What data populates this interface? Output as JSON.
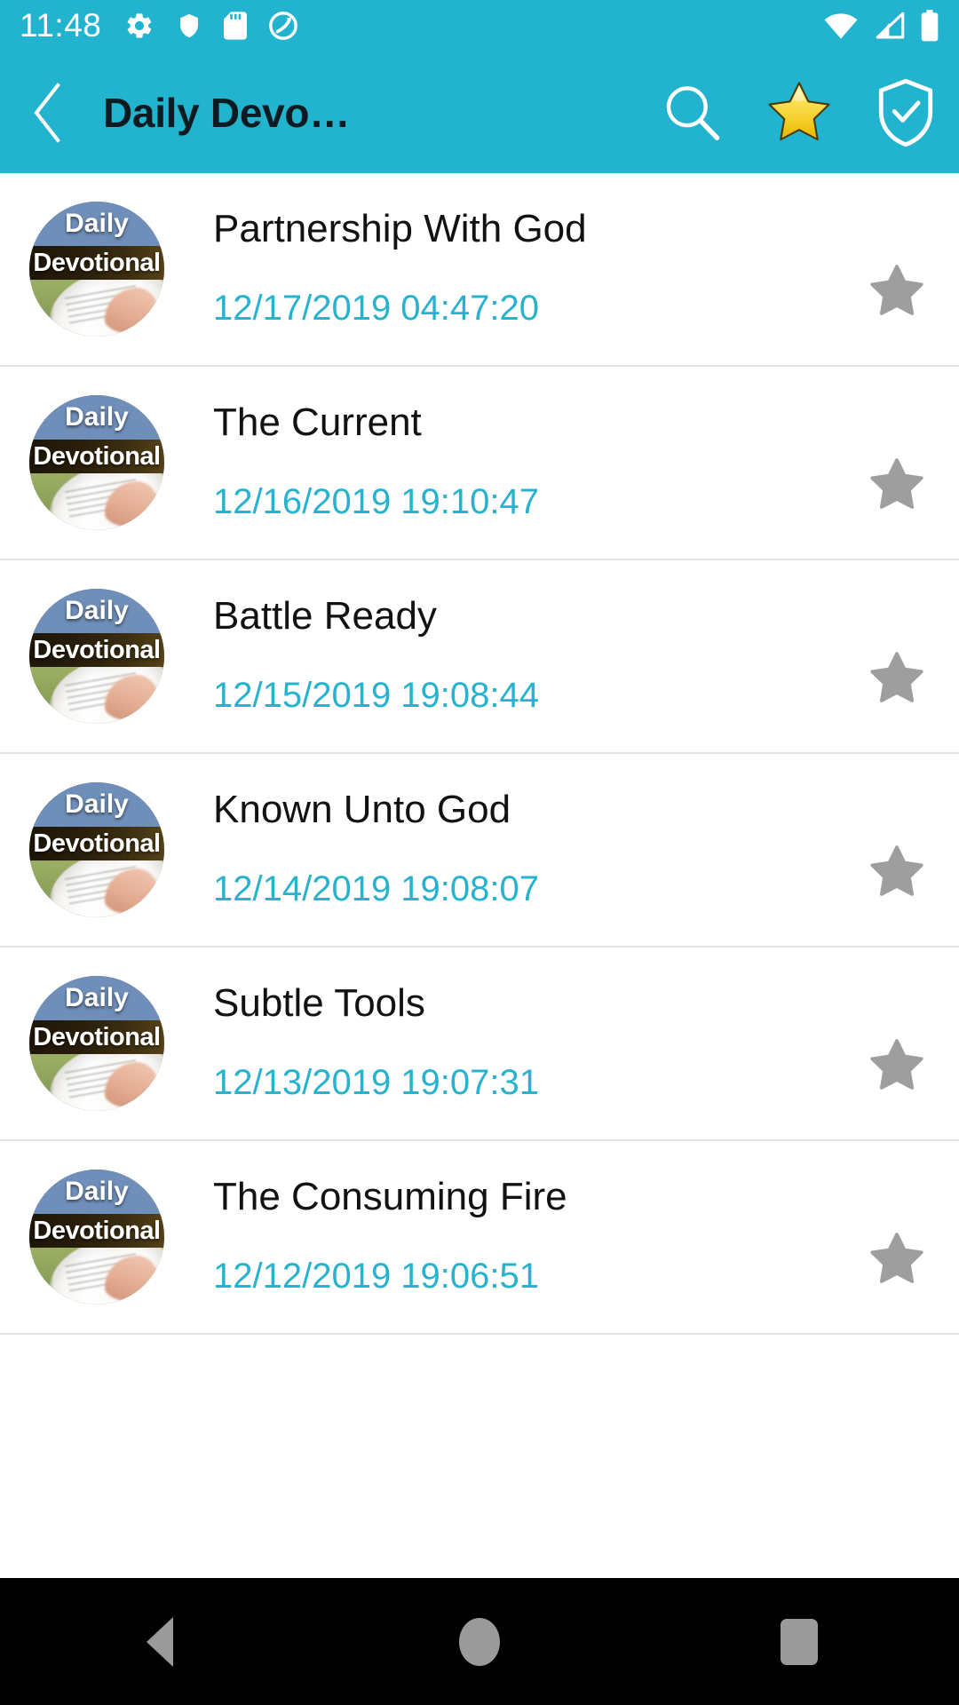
{
  "status_bar": {
    "time": "11:48",
    "left_icons": [
      "gear-icon",
      "shield-icon",
      "sd-card-icon",
      "circle-slash-icon"
    ],
    "right_icons": [
      "wifi-icon",
      "cellular-signal-icon",
      "battery-icon"
    ],
    "background_color": "#22b4cf"
  },
  "app_bar": {
    "back_icon": "chevron-left-icon",
    "title": "Daily Devo…",
    "actions": [
      {
        "name": "search-icon",
        "label": "Search"
      },
      {
        "name": "favorites-star-icon",
        "label": "Favorites"
      },
      {
        "name": "shield-check-icon",
        "label": "Protected"
      }
    ],
    "background_color": "#22b4cf",
    "title_color": "#0c1b22"
  },
  "list": {
    "thumbnail": {
      "line1": "Daily",
      "line2": "Devotional"
    },
    "date_color": "#27b3cf",
    "star_color": "#9e9e9e",
    "items": [
      {
        "title": "Partnership With God",
        "date": "12/17/2019 04:47:20",
        "starred": false
      },
      {
        "title": "The Current",
        "date": "12/16/2019 19:10:47",
        "starred": false
      },
      {
        "title": "Battle Ready",
        "date": "12/15/2019 19:08:44",
        "starred": false
      },
      {
        "title": "Known Unto God",
        "date": "12/14/2019 19:08:07",
        "starred": false
      },
      {
        "title": "Subtle Tools",
        "date": "12/13/2019 19:07:31",
        "starred": false
      },
      {
        "title": "The Consuming Fire",
        "date": "12/12/2019 19:06:51",
        "starred": false
      }
    ]
  },
  "nav_bar": {
    "background_color": "#000000",
    "buttons": [
      {
        "name": "nav-back-button",
        "icon": "triangle-left-icon"
      },
      {
        "name": "nav-home-button",
        "icon": "circle-icon"
      },
      {
        "name": "nav-recents-button",
        "icon": "square-icon"
      }
    ]
  }
}
